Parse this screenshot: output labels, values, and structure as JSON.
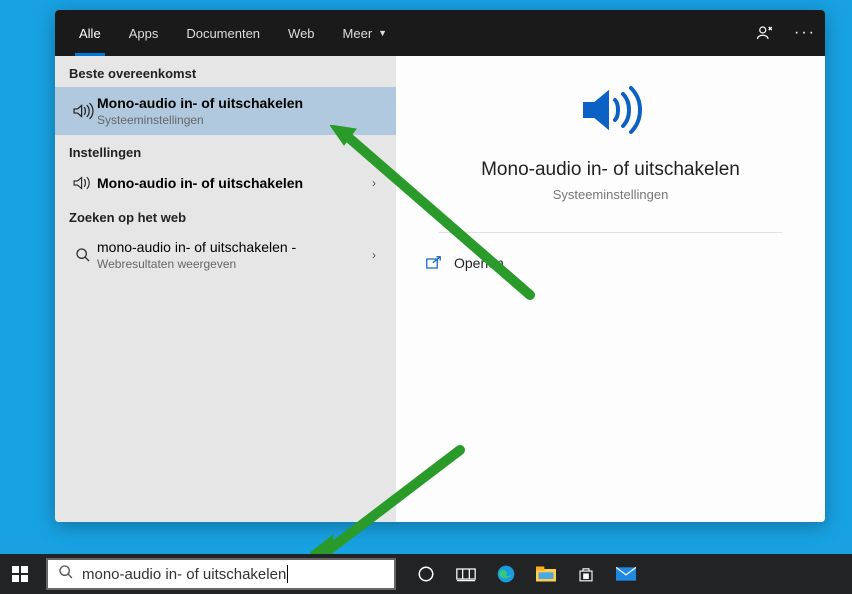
{
  "tabs": {
    "all": "Alle",
    "apps": "Apps",
    "documents": "Documenten",
    "web": "Web",
    "more": "Meer"
  },
  "sections": {
    "best_match": "Beste overeenkomst",
    "settings": "Instellingen",
    "web": "Zoeken op het web"
  },
  "best": {
    "title": "Mono-audio in- of uitschakelen",
    "sub": "Systeeminstellingen"
  },
  "settings_item": {
    "title": "Mono-audio in- of uitschakelen"
  },
  "web_item": {
    "title": "mono-audio in- of uitschakelen -",
    "sub": "Webresultaten weergeven"
  },
  "detail": {
    "title": "Mono-audio in- of uitschakelen",
    "sub": "Systeeminstellingen",
    "open": "Openen"
  },
  "search": {
    "value": "mono-audio in- of uitschakelen"
  }
}
